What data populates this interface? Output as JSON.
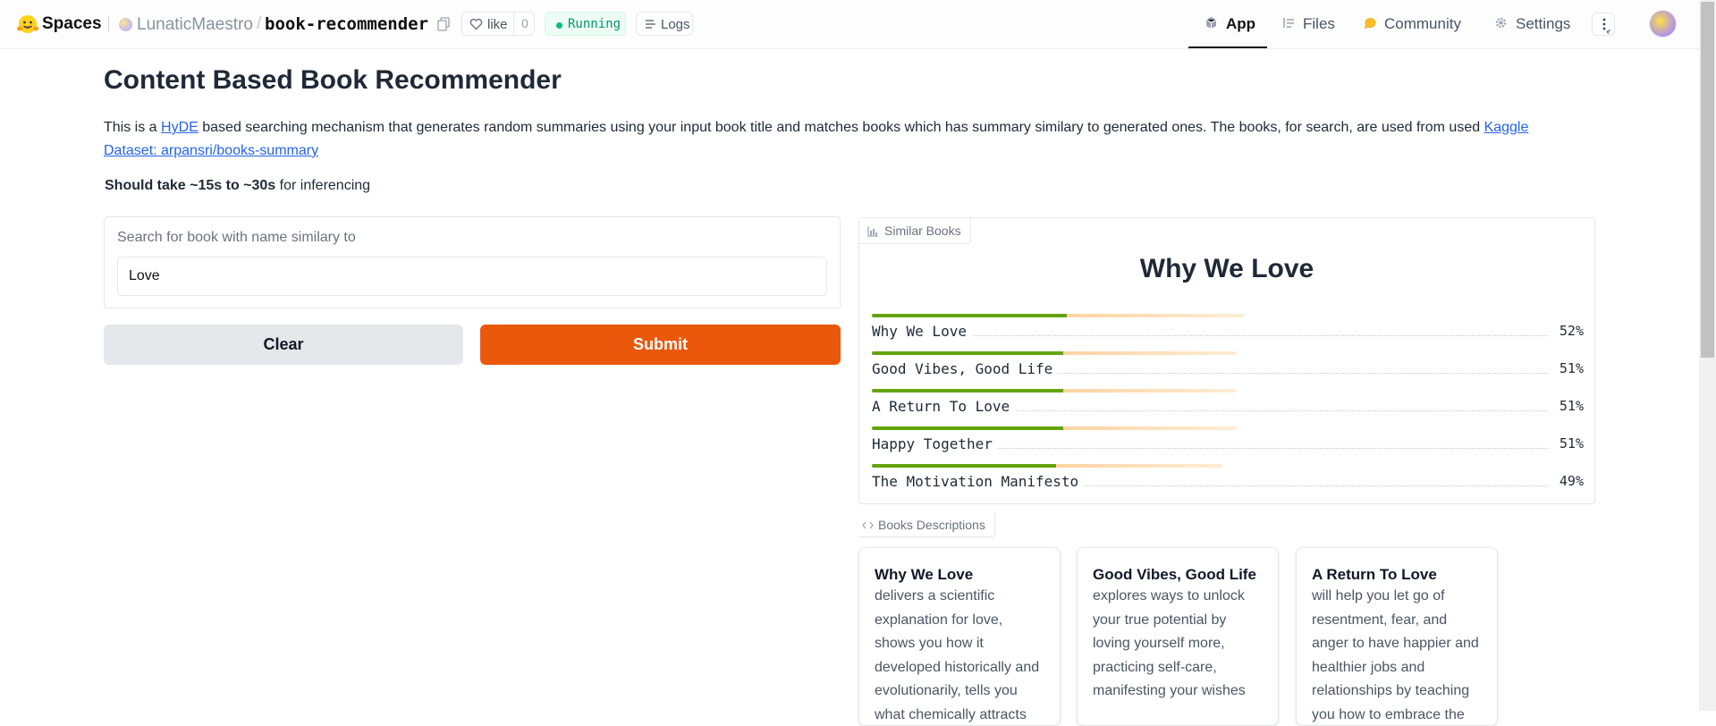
{
  "header": {
    "brand": "Spaces",
    "owner": "LunaticMaestro",
    "repo": "book-recommender",
    "like_label": "like",
    "like_count": "0",
    "status": "Running",
    "logs_label": "Logs",
    "tabs": [
      {
        "label": "App",
        "icon": "cube-icon"
      },
      {
        "label": "Files",
        "icon": "files-icon"
      },
      {
        "label": "Community",
        "icon": "community-icon"
      },
      {
        "label": "Settings",
        "icon": "gear-icon"
      }
    ]
  },
  "main": {
    "title": "Content Based Book Recommender",
    "desc_pre": "This is a ",
    "desc_link1": "HyDE",
    "desc_mid": " based searching mechanism that generates random summaries using your input book title and matches books which has summary similary to generated ones. The books, for search, are used from used ",
    "desc_link2": "Kaggle Dataset: arpansri/books-summary",
    "note_bold": "Should take ~15s to ~30s",
    "note_rest": " for inferencing",
    "search_label": "Search for book with name similary to",
    "search_value": "Love",
    "clear_label": "Clear",
    "submit_label": "Submit"
  },
  "results": {
    "tag": "Similar Books",
    "top_label": "Why We Love",
    "items": [
      {
        "name": "Why We Love",
        "pct": "52%",
        "value": 0.52
      },
      {
        "name": "Good Vibes, Good Life",
        "pct": "51%",
        "value": 0.51
      },
      {
        "name": "A Return To Love",
        "pct": "51%",
        "value": 0.51
      },
      {
        "name": "Happy Together",
        "pct": "51%",
        "value": 0.51
      },
      {
        "name": "The Motivation Manifesto",
        "pct": "49%",
        "value": 0.49
      }
    ]
  },
  "descriptions": {
    "tag": "Books Descriptions",
    "cards": [
      {
        "title": "Why We Love",
        "body": "delivers a scientific explanation for love, shows you how it developed historically and evolutionarily, tells you what chemically attracts us"
      },
      {
        "title": "Good Vibes, Good Life",
        "body": "explores ways to unlock your true potential by loving yourself more, practicing self-care, manifesting your wishes"
      },
      {
        "title": "A Return To Love",
        "body": "will help you let go of resentment, fear, and anger to have happier and healthier jobs and relationships by teaching you how to embrace the"
      }
    ]
  }
}
